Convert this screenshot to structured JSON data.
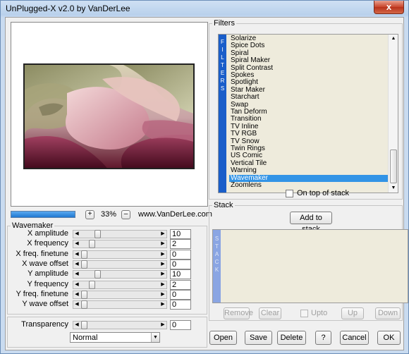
{
  "window": {
    "title": "UnPlugged-X v2.0 by VanDerLee",
    "close_label": "x"
  },
  "preview": {
    "zoom_in_label": "+",
    "zoom_value": "33%",
    "zoom_out_label": "–",
    "website": "www.VanDerLee.com"
  },
  "wavemaker": {
    "group_title": "Wavemaker",
    "params": [
      {
        "label": "X amplitude",
        "value": "10",
        "level": 0.1
      },
      {
        "label": "X frequency",
        "value": "2",
        "level": 0.02
      },
      {
        "label": "X freq. finetune",
        "value": "0",
        "level": 0.0
      },
      {
        "label": "X wave offset",
        "value": "0",
        "level": 0.0
      },
      {
        "label": "Y amplitude",
        "value": "10",
        "level": 0.1
      },
      {
        "label": "Y frequency",
        "value": "2",
        "level": 0.02
      },
      {
        "label": "Y freq. finetune",
        "value": "0",
        "level": 0.0
      },
      {
        "label": "Y wave offset",
        "value": "0",
        "level": 0.0
      }
    ],
    "transparency": {
      "label": "Transparency",
      "value": "0",
      "level": 0.0
    },
    "blend_mode": "Normal"
  },
  "filters": {
    "group_title": "Filters",
    "tab_letters": [
      "F",
      "I",
      "L",
      "T",
      "E",
      "R",
      "S"
    ],
    "items": [
      "Solarize",
      "Spice Dots",
      "Spiral",
      "Spiral Maker",
      "Split Contrast",
      "Spokes",
      "Spotlight",
      "Star Maker",
      "Starchart",
      "Swap",
      "Tan Deform",
      "Transition",
      "TV Inline",
      "TV RGB",
      "TV Snow",
      "Twin Rings",
      "US Comic",
      "Vertical Tile",
      "Warning",
      "Wavemaker",
      "Zoomlens"
    ],
    "selected_item": "Wavemaker",
    "on_top_label": "On top of stack",
    "on_top_checked": false
  },
  "stack": {
    "group_title": "Stack",
    "add_label": "Add to stack",
    "tab_letters": [
      "S",
      "T",
      "A",
      "C",
      "K"
    ],
    "remove_label": "Remove",
    "clear_label": "Clear",
    "upto_label": "Upto",
    "up_label": "Up",
    "down_label": "Down"
  },
  "footer": {
    "open_label": "Open",
    "save_label": "Save",
    "delete_label": "Delete",
    "help_label": "?",
    "cancel_label": "Cancel",
    "ok_label": "OK"
  },
  "colors": {
    "selection": "#3294e6",
    "filter_tab": "#1a5ec9",
    "list_bg": "#eeebdc",
    "close_red": "#c8452b"
  }
}
